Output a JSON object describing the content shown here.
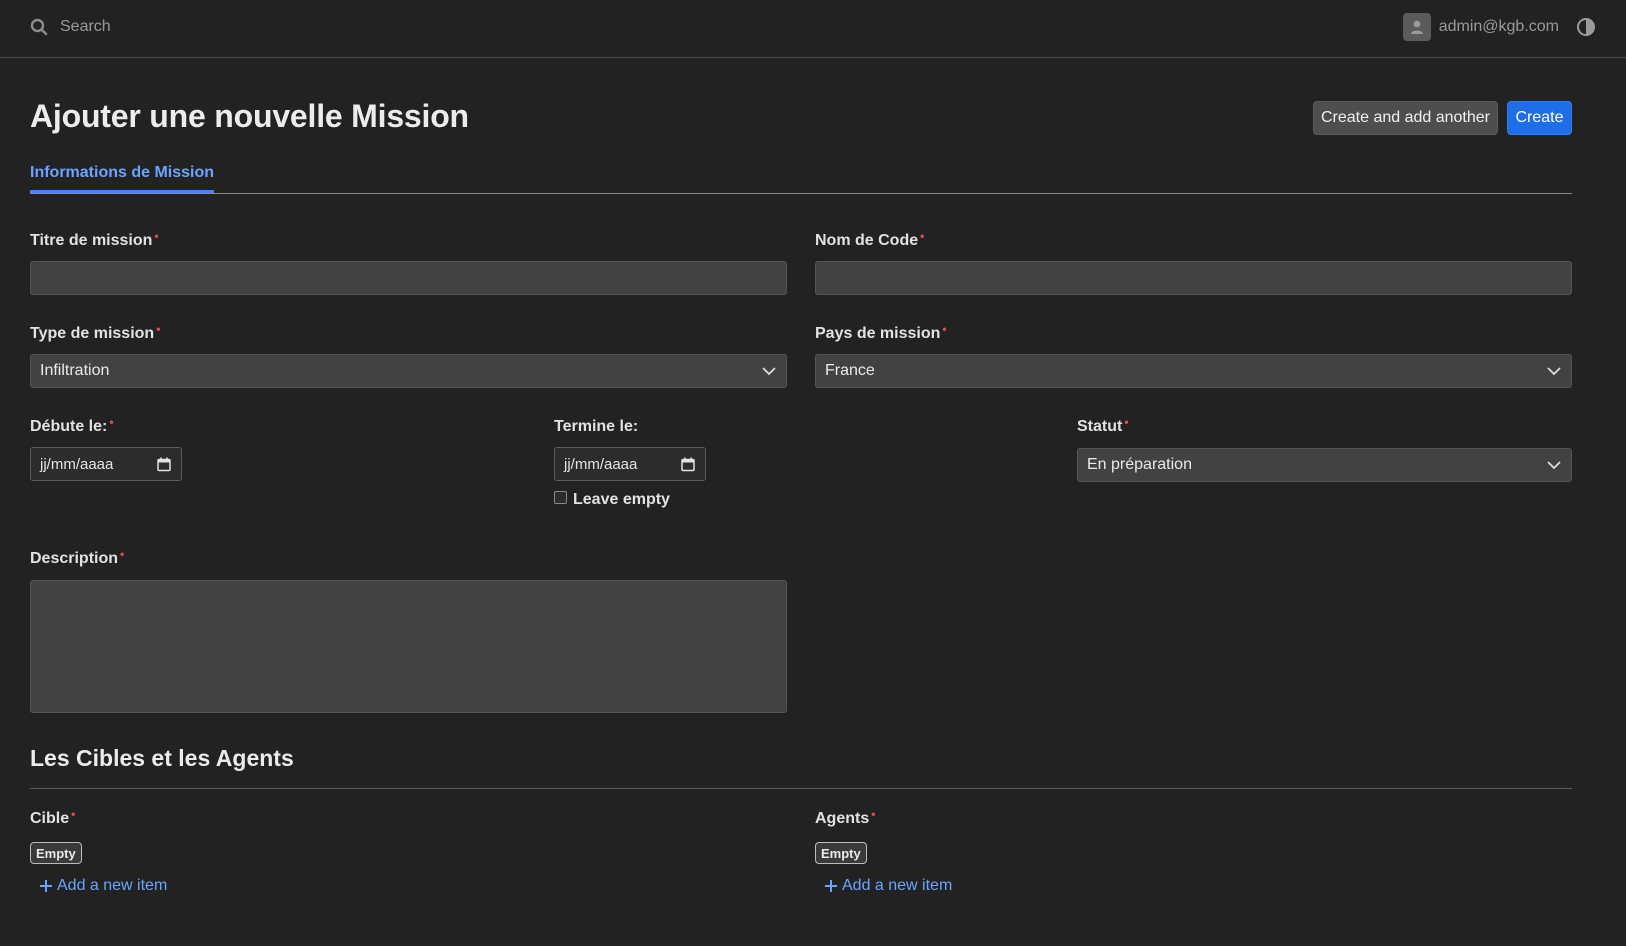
{
  "topbar": {
    "search_placeholder": "Search",
    "user_email": "admin@kgb.com",
    "icons": [
      "search-icon",
      "user-icon",
      "contrast-icon"
    ]
  },
  "header": {
    "title": "Ajouter une nouvelle Mission",
    "create_another_label": "Create and add another",
    "create_label": "Create"
  },
  "tabs": [
    {
      "label": "Informations de Mission",
      "active": true
    }
  ],
  "form": {
    "required_marker": "•",
    "titre": {
      "label": "Titre de mission",
      "value": ""
    },
    "nom_code": {
      "label": "Nom de Code",
      "value": ""
    },
    "type": {
      "label": "Type de mission",
      "value": "Infiltration"
    },
    "pays": {
      "label": "Pays de mission",
      "value": "France"
    },
    "debut": {
      "label": "Débute le:",
      "placeholder": "jj/mm/aaaa"
    },
    "fin": {
      "label": "Termine le:",
      "placeholder": "jj/mm/aaaa",
      "leave_empty_label": "Leave empty",
      "leave_empty_checked": false
    },
    "statut": {
      "label": "Statut",
      "value": "En préparation"
    },
    "description": {
      "label": "Description",
      "value": ""
    }
  },
  "section": {
    "title": "Les Cibles et les Agents",
    "cible": {
      "label": "Cible",
      "empty_label": "Empty",
      "add_label": "Add a new item"
    },
    "agents": {
      "label": "Agents",
      "empty_label": "Empty",
      "add_label": "Add a new item"
    }
  },
  "colors": {
    "background": "#222222",
    "accent": "#1e6ee8",
    "link": "#6ba4ff",
    "required": "#e14c4c"
  }
}
